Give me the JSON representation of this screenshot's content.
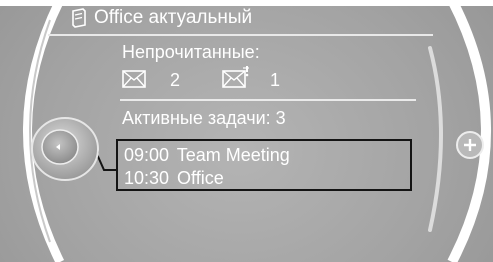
{
  "header": {
    "title": "Office актуальный",
    "icon": "office-icon"
  },
  "unread": {
    "label": "Непрочитанные:",
    "mail_icon": "mail-icon",
    "mail_count": "2",
    "flag_icon": "mail-flagged-icon",
    "flag_count": "1"
  },
  "tasks": {
    "label": "Активные задачи: 3"
  },
  "appointments": [
    {
      "time": "09:00",
      "title": "Team Meeting"
    },
    {
      "time": "10:30",
      "title": "Office"
    }
  ],
  "controls": {
    "controller_icon": "controller-knob-icon",
    "plus_icon": "plus-icon"
  },
  "colors": {
    "background": "#a7a7a7",
    "text": "#ffffff",
    "highlight_border": "#141414"
  }
}
